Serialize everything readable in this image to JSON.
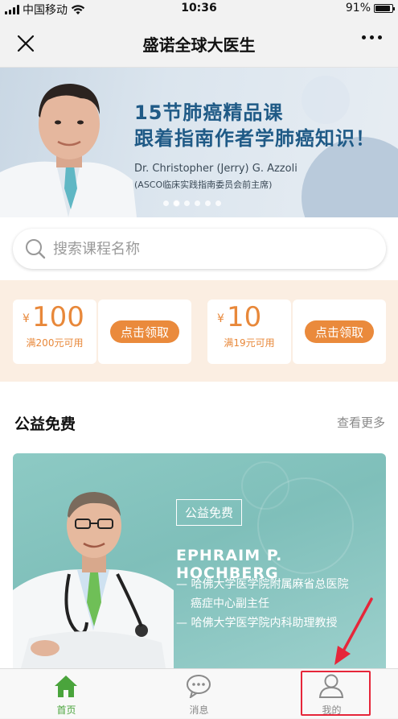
{
  "status_bar": {
    "carrier": "中国移动",
    "time": "10:36",
    "battery": "91%",
    "battery_level": 0.91
  },
  "nav": {
    "title": "盛诺全球大医生",
    "close_icon": "close-icon",
    "more_icon": "more-icon"
  },
  "banner": {
    "line1": "15节肺癌精品课",
    "line2": "跟着指南作者学肺癌知识！",
    "name": "Dr. Christopher (Jerry) G. Azzoli",
    "role": "(ASCO临床实践指南委员会前主席)",
    "active_slide": 2,
    "slide_count": 6
  },
  "search": {
    "placeholder": "搜索课程名称"
  },
  "coupons": [
    {
      "currency": "¥",
      "amount": "100",
      "condition": "满200元可用",
      "button": "点击领取"
    },
    {
      "currency": "¥",
      "amount": "10",
      "condition": "满19元可用",
      "button": "点击领取"
    }
  ],
  "section": {
    "title": "公益免费",
    "more": "查看更多"
  },
  "course_card": {
    "tag": "公益免费",
    "name": "EPHRAIM P. HOCHBERG",
    "line1": "— 哈佛大学医学院附属麻省总医院",
    "line2": "癌症中心副主任",
    "line3": "— 哈佛大学医学院内科助理教授"
  },
  "tab_bar": {
    "items": [
      {
        "label": "首页",
        "icon": "home-icon",
        "active": true
      },
      {
        "label": "消息",
        "icon": "message-icon",
        "active": false
      },
      {
        "label": "我的",
        "icon": "profile-icon",
        "active": false
      }
    ]
  },
  "colors": {
    "accent_green": "#4aa43c",
    "coupon_orange": "#ea8a3c",
    "highlight_red": "#e6263a",
    "banner_title": "#1f5a86"
  }
}
